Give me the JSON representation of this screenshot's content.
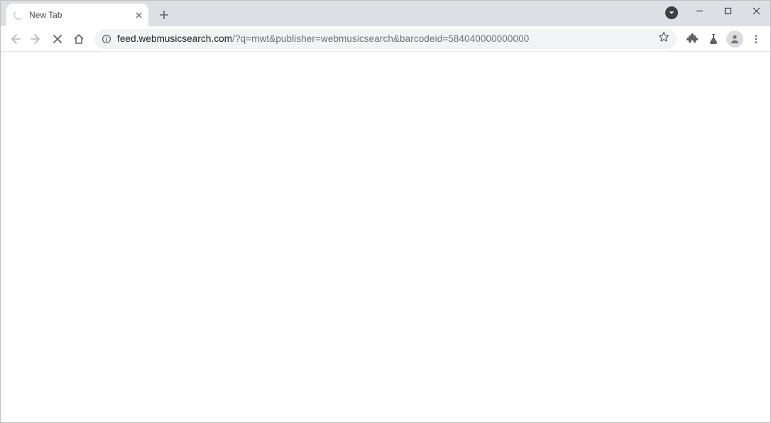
{
  "tab": {
    "title": "New Tab"
  },
  "url": {
    "host": "feed.webmusicsearch.com",
    "path": "/?q=mwt&publisher=webmusicsearch&barcodeid=584040000000000"
  }
}
